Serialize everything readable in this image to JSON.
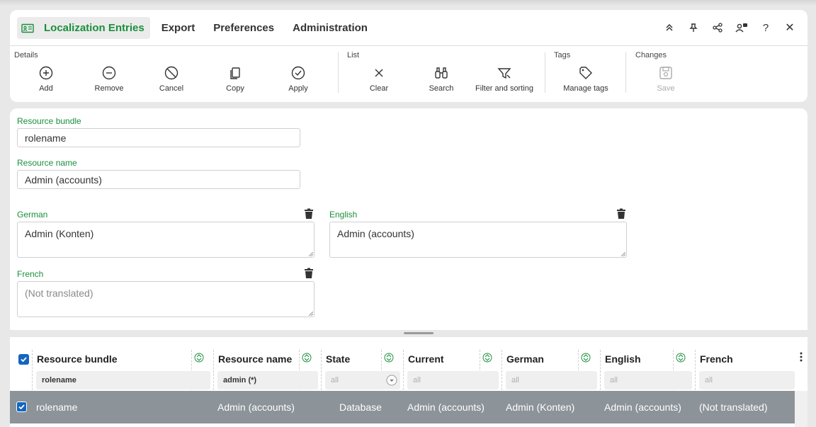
{
  "header": {
    "tabs": [
      {
        "label": "Localization Entries",
        "active": true,
        "icon": "id-card-icon"
      },
      {
        "label": "Export"
      },
      {
        "label": "Preferences"
      },
      {
        "label": "Administration"
      }
    ],
    "window_actions": [
      "collapse-up-icon",
      "pin-icon",
      "share-icon",
      "user-admin-icon",
      "help-icon",
      "close-icon"
    ],
    "help_glyph": "?",
    "close_glyph": "✕"
  },
  "toolbar": {
    "groups": {
      "details": "Details",
      "list": "List",
      "tags": "Tags",
      "changes": "Changes"
    },
    "add": "Add",
    "remove": "Remove",
    "cancel": "Cancel",
    "copy": "Copy",
    "apply": "Apply",
    "clear": "Clear",
    "search": "Search",
    "filter_sorting": "Filter and sorting",
    "manage_tags": "Manage tags",
    "save": "Save"
  },
  "form": {
    "resource_bundle": {
      "label": "Resource bundle",
      "value": "rolename"
    },
    "resource_name": {
      "label": "Resource name",
      "value": "Admin (accounts)"
    },
    "german": {
      "label": "German",
      "value": "Admin (Konten)"
    },
    "english": {
      "label": "English",
      "value": "Admin (accounts)"
    },
    "french": {
      "label": "French",
      "placeholder": "(Not translated)"
    }
  },
  "grid": {
    "columns": [
      "Resource bundle",
      "Resource name",
      "State",
      "Current",
      "German",
      "English",
      "French"
    ],
    "filters": [
      "rolename",
      "admin (*)",
      "all",
      "all",
      "all",
      "all",
      "all"
    ],
    "rows": [
      {
        "selected": true,
        "cells": [
          "rolename",
          "Admin (accounts)",
          "Database",
          "Admin (accounts)",
          "Admin (Konten)",
          "Admin (accounts)",
          "(Not translated)"
        ]
      }
    ]
  },
  "colors": {
    "accent_green": "#1a8f3c",
    "checkbox_blue": "#1565c0",
    "selected_row": "#8c9399"
  }
}
